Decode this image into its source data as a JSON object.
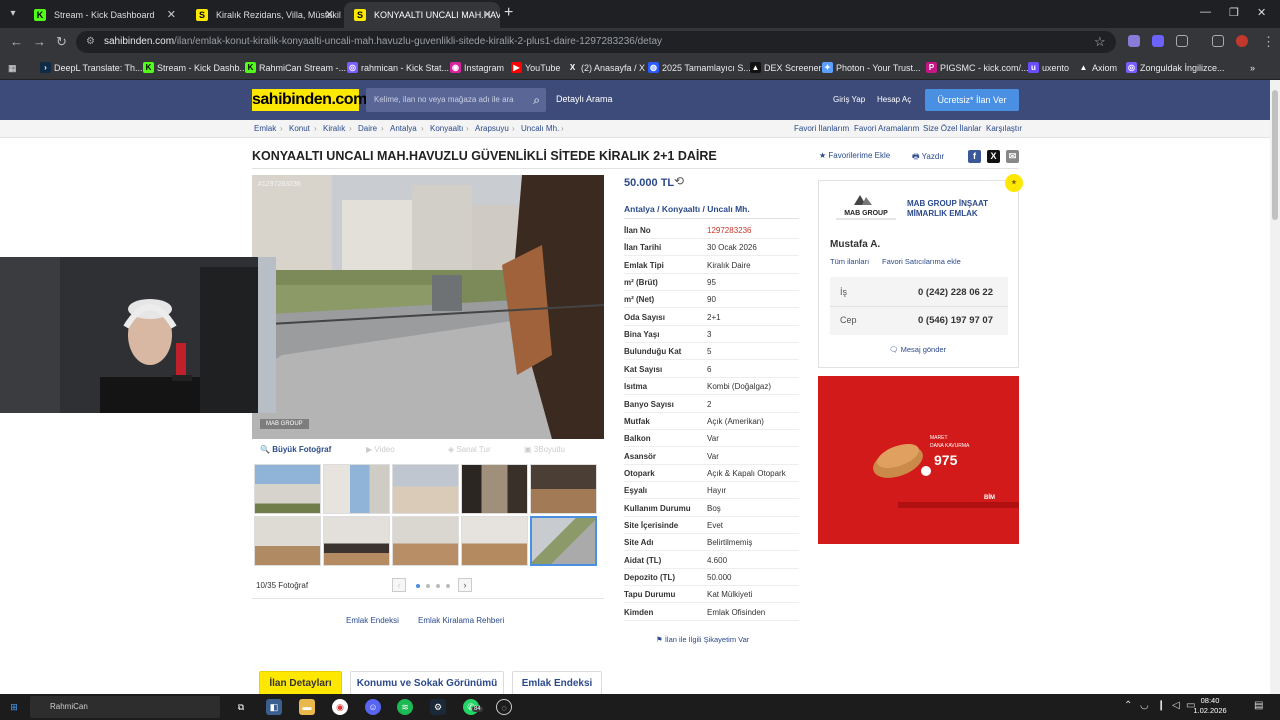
{
  "browser": {
    "tabs": [
      {
        "title": "Stream - Kick Dashboard",
        "icon": "kick-icon"
      },
      {
        "title": "Kiralık Rezidans, Villa, Müstakil",
        "icon": "sahibinden-icon"
      },
      {
        "title": "KONYAALTI UNCALI MAH.HAVU",
        "icon": "sahibinden-icon"
      }
    ],
    "url_host": "sahibinden.com",
    "url_path": "/ilan/emlak-konut-kiralik-konyaalti-uncali-mah.havuzlu-guvenlikli-sitede-kiralik-2-plus1-daire-1297283236/detay",
    "bookmarks": [
      "DeepL Translate: Th...",
      "Stream - Kick Dashb...",
      "RahmiCan Stream -...",
      "rahmican - Kick Stat...",
      "Instagram",
      "YouTube",
      "(2) Anasayfa / X",
      "2025 Tamamlayıcı S...",
      "DEX Screener",
      "Photon - Your Trust...",
      "PIGSMC - kick.com/...",
      "uxento",
      "Axiom",
      "Zonguldak İngilizce..."
    ]
  },
  "site": {
    "logo": "sahibinden.com",
    "search_placeholder": "Kelime, ilan no veya mağaza adı ile ara",
    "detail_search": "Detaylı Arama",
    "login": "Giriş Yap",
    "register": "Hesap Aç",
    "post_ad": "Ücretsiz* İlan Ver"
  },
  "breadcrumb": [
    "Emlak",
    "Konut",
    "Kiralık",
    "Daire",
    "Antalya",
    "Konyaaltı",
    "Arapsuyu",
    "Uncalı Mh."
  ],
  "breadcrumb_right": [
    "Favori İlanlarım",
    "Favori Aramalarım",
    "Size Özel İlanlar",
    "Karşılaştır"
  ],
  "listing": {
    "title": "KONYAALTI UNCALI MAH.HAVUZLU GÜVENLİKLİ SİTEDE KİRALIK 2+1 DAİRE",
    "favorite": "Favorilerime Ekle",
    "print": "Yazdır",
    "price": "50.000 TL",
    "location": [
      "Antalya",
      "Konyaaltı",
      "Uncalı Mh."
    ],
    "photo_id": "#1297283236",
    "photo_watermark": "MAB GROUP",
    "photo_tools": [
      "Büyük Fotoğraf",
      "Video",
      "Sanal Tur",
      "3Boyutlu"
    ],
    "photo_count": "10/35 Fotoğraf",
    "under_links": [
      "Emlak Endeksi",
      "Emlak Kiralama Rehberi"
    ],
    "complaint": "İlan ile İlgili Şikayetim Var",
    "details": [
      {
        "k": "İlan No",
        "v": "1297283236"
      },
      {
        "k": "İlan Tarihi",
        "v": "30 Ocak 2026"
      },
      {
        "k": "Emlak Tipi",
        "v": "Kiralık Daire"
      },
      {
        "k": "m² (Brüt)",
        "v": "95"
      },
      {
        "k": "m² (Net)",
        "v": "90"
      },
      {
        "k": "Oda Sayısı",
        "v": "2+1"
      },
      {
        "k": "Bina Yaşı",
        "v": "3"
      },
      {
        "k": "Bulunduğu Kat",
        "v": "5"
      },
      {
        "k": "Kat Sayısı",
        "v": "6"
      },
      {
        "k": "Isıtma",
        "v": "Kombi (Doğalgaz)"
      },
      {
        "k": "Banyo Sayısı",
        "v": "2"
      },
      {
        "k": "Mutfak",
        "v": "Açık (Amerikan)"
      },
      {
        "k": "Balkon",
        "v": "Var"
      },
      {
        "k": "Asansör",
        "v": "Var"
      },
      {
        "k": "Otopark",
        "v": "Açık & Kapalı Otopark"
      },
      {
        "k": "Eşyalı",
        "v": "Hayır"
      },
      {
        "k": "Kullanım Durumu",
        "v": "Boş"
      },
      {
        "k": "Site İçerisinde",
        "v": "Evet"
      },
      {
        "k": "Site Adı",
        "v": "Belirtilmemiş"
      },
      {
        "k": "Aidat (TL)",
        "v": "4.600"
      },
      {
        "k": "Depozito (TL)",
        "v": "50.000"
      },
      {
        "k": "Tapu Durumu",
        "v": "Kat Mülkiyeti"
      },
      {
        "k": "Kimden",
        "v": "Emlak Ofisinden"
      }
    ]
  },
  "seller": {
    "logo_text": "MAB GROUP",
    "company": "MAB GROUP İNŞAAT MİMARLIK EMLAK",
    "agent": "Mustafa A.",
    "all_ads": "Tüm ilanları",
    "fav_seller": "Favori Satıcılarıma ekle",
    "phones": [
      {
        "label": "İş",
        "number": "0 (242) 228 06 22"
      },
      {
        "label": "Cep",
        "number": "0 (546) 197 97 07"
      }
    ],
    "message": "Mesaj gönder"
  },
  "ad": {
    "line1": "MARET",
    "line2": "DANA KAVURMA",
    "price": "975",
    "brand": "BİM"
  },
  "bottom_tabs": [
    "İlan Detayları",
    "Konumu ve Sokak Görünümü",
    "Emlak Endeksi"
  ],
  "taskbar": {
    "search_text": "RahmiCan",
    "badge": "84",
    "time": "08:40",
    "date": "1.02.2026"
  },
  "colors": {
    "site_header": "#3d4b7a",
    "brand_yellow": "#ffe800",
    "link_blue": "#2b4a8b",
    "post_button": "#4a90e2"
  }
}
